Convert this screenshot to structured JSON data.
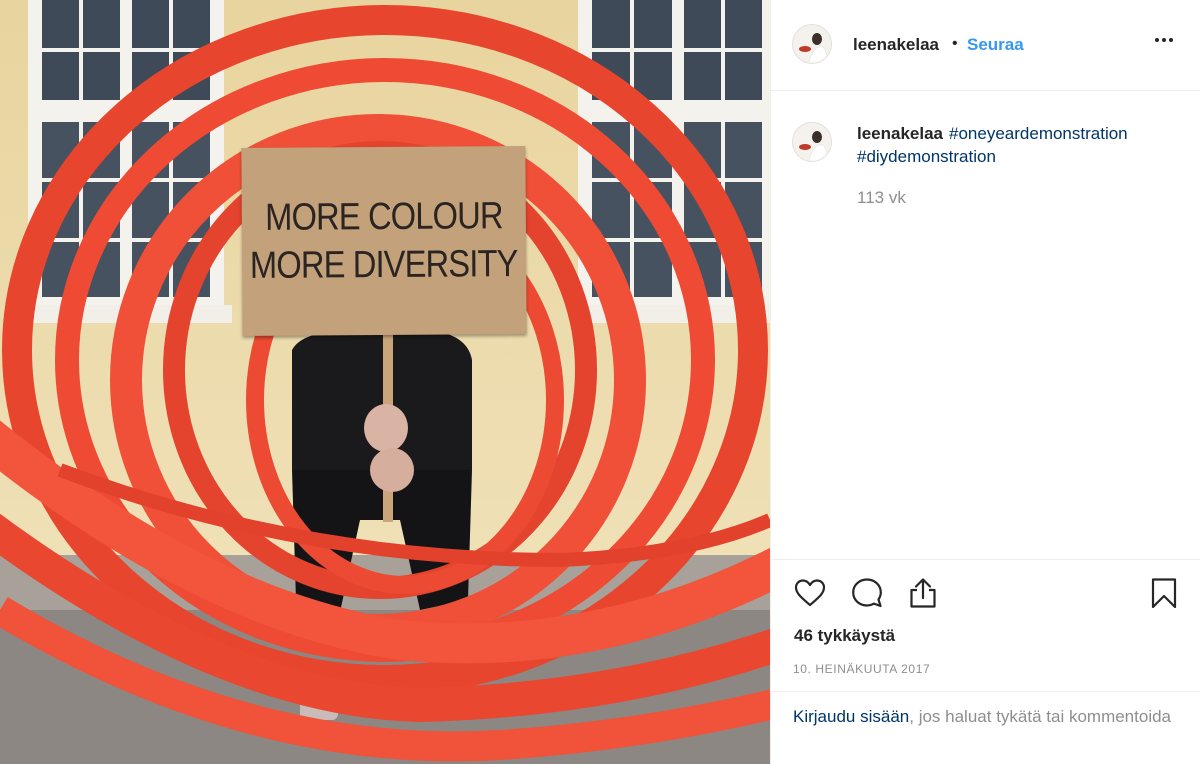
{
  "photo": {
    "alt": "",
    "sign_line1": "MORE COLOUR",
    "sign_line2": "MORE DIVERSITY"
  },
  "header": {
    "username": "leenakelaa",
    "separator": "•",
    "follow_label": "Seuraa",
    "more_icon": "more-options-icon"
  },
  "caption": {
    "username": "leenakelaa",
    "hashtags": [
      "#oneyeardemonstration",
      "#diydemonstration"
    ],
    "age": "113 vk"
  },
  "actions": {
    "icons": [
      "heart-icon",
      "comment-icon",
      "share-icon",
      "bookmark-icon"
    ],
    "likes": "46 tykkäystä",
    "date": "10. HEINÄKUUTA 2017"
  },
  "login_prompt": {
    "link": "Kirjaudu sisään",
    "text": ", jos haluat tykätä tai kommentoida"
  },
  "colors": {
    "accent_blue": "#3897f0",
    "link_dark": "#003569",
    "sculpture_red": "#e8452f"
  }
}
